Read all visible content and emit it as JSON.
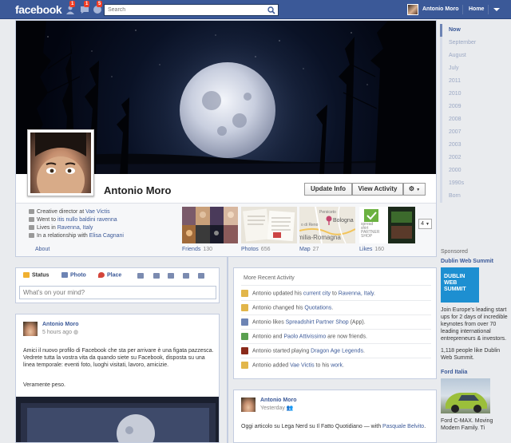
{
  "topbar": {
    "logo": "facebook",
    "search_placeholder": "Search",
    "notifications": [
      "1",
      "1",
      "5"
    ],
    "user_name": "Antonio Moro",
    "home_label": "Home"
  },
  "profile": {
    "name": "Antonio Moro",
    "update_info": "Update Info",
    "view_activity": "View Activity",
    "info": [
      {
        "prefix": "Creative director at ",
        "link": "Vae Victis"
      },
      {
        "prefix": "Went to ",
        "link": "itis nullo baldini ravenna"
      },
      {
        "prefix": "Lives in ",
        "link": "Ravenna, Italy"
      },
      {
        "prefix": "In a relationship with ",
        "link": "Elisa Cagnani"
      }
    ],
    "about": "About",
    "tiles": [
      {
        "label": "Friends",
        "count": "130"
      },
      {
        "label": "Photos",
        "count": "656"
      },
      {
        "label": "Map",
        "count": "27"
      },
      {
        "label": "Likes",
        "count": "160"
      }
    ],
    "map_city": "Bologna",
    "map_region": "milia-Romagna",
    "map_places": [
      "Persiceto",
      "o di Reno"
    ],
    "likes_brand": [
      "spread",
      "shirt",
      "PARTNER",
      "SHOP"
    ],
    "more_count": "4"
  },
  "timeline_nav": [
    "Now",
    "September",
    "August",
    "July",
    "2011",
    "2010",
    "2009",
    "2008",
    "2007",
    "2003",
    "2002",
    "2000",
    "1990s",
    "Born"
  ],
  "sponsored": {
    "header": "Sponsored",
    "ads": [
      {
        "title": "Dublin Web Summit",
        "image_text": [
          "DUBLIN",
          "WEB",
          "SUMMIT"
        ],
        "text": "Join Europe's leading start ups for 2 days of incredible keynotes from over 70 leading international entrepreneurs & investors.",
        "social": "1,118 people like Dublin Web Summit."
      },
      {
        "title": "Ford Italia",
        "text": "Ford C-MAX. Moving Modern Family. Ti"
      }
    ]
  },
  "composer": {
    "tabs": [
      "Status",
      "Photo",
      "Place"
    ],
    "placeholder": "What's on your mind?"
  },
  "recent_activity": {
    "header": "More Recent Activity",
    "items": [
      {
        "parts": [
          "Antonio updated his ",
          "current city",
          " to ",
          "Ravenna, Italy",
          "."
        ]
      },
      {
        "parts": [
          "Antonio changed his ",
          "Quotations",
          "."
        ]
      },
      {
        "parts": [
          "Antonio likes ",
          "Spreadshirt Partner Shop",
          " (App)."
        ]
      },
      {
        "parts": [
          "Antonio and ",
          "Paolo Attivissimo",
          " are now friends."
        ]
      },
      {
        "parts": [
          "Antonio started playing ",
          "Dragon Age Legends",
          "."
        ]
      },
      {
        "parts": [
          "Antonio added ",
          "Vae Victis",
          " to his ",
          "work",
          "."
        ]
      }
    ]
  },
  "posts": [
    {
      "author": "Antonio Moro",
      "time": "5 hours ago",
      "text": "Amici il nuovo profilo di Facebook che sta per arrivare è una figata pazzesca. Vedrete tutta la vostra vita da quando siete su Facebook, disposta su una linea temporale: eventi foto, luoghi visitati, lavoro, amicizie.",
      "text2": "Veramente peso."
    },
    {
      "author": "Antonio Moro",
      "time": "Yesterday",
      "text": "Oggi articolo su Lega Nerd su Il Fatto Quotidiano — with ",
      "link": "Pasquale Belvito",
      "text_end": "."
    }
  ],
  "colors": {
    "brand": "#3b5998",
    "background": "#e9ebee",
    "notification": "#f03d25"
  }
}
